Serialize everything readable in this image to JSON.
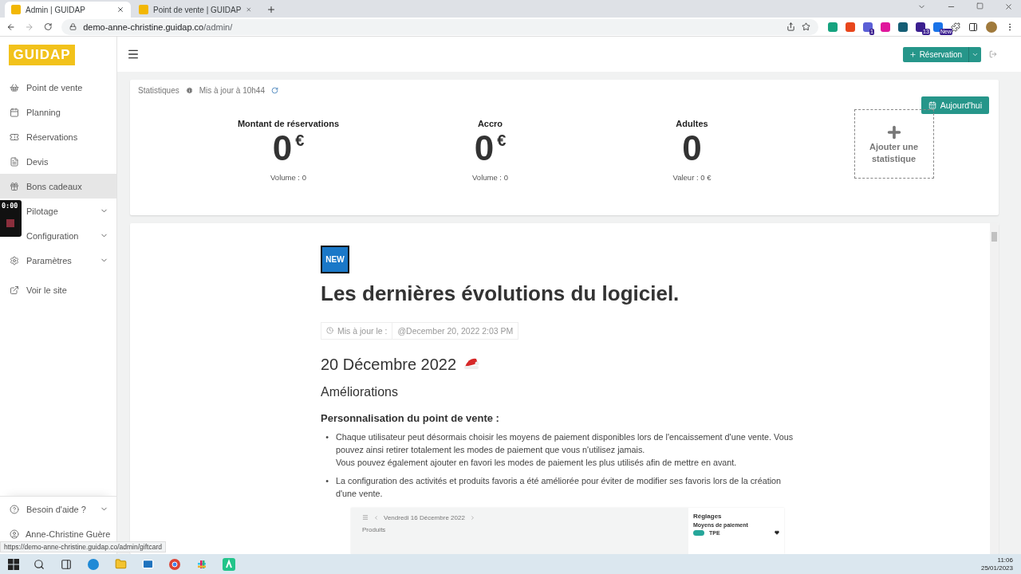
{
  "browser": {
    "tabs": [
      {
        "title": "Admin | GUIDAP",
        "selected": true
      },
      {
        "title": "Point de vente | GUIDAP",
        "selected": false
      }
    ],
    "url_host": "demo-anne-christine.guidap.co",
    "url_path": "/admin/",
    "extensions": [
      {
        "color": "#16a37f"
      },
      {
        "color": "#e8461c"
      },
      {
        "color": "#5b5fd6",
        "badge": "1"
      },
      {
        "color": "#e0179c"
      },
      {
        "color": "#155e75"
      },
      {
        "color": "#3b1f8f",
        "badge": "13"
      },
      {
        "color": "#1a73e8",
        "badge": "New"
      }
    ]
  },
  "sidebar": {
    "logo": "GUIDAP",
    "items": [
      {
        "label": "Point de vente",
        "hovered": false,
        "expandable": false
      },
      {
        "label": "Planning",
        "hovered": false,
        "expandable": false
      },
      {
        "label": "Réservations",
        "hovered": false,
        "expandable": false
      },
      {
        "label": "Devis",
        "hovered": false,
        "expandable": false
      },
      {
        "label": "Bons cadeaux",
        "hovered": true,
        "expandable": false
      },
      {
        "label": "Pilotage",
        "hovered": false,
        "expandable": true
      },
      {
        "label": "Configuration",
        "hovered": false,
        "expandable": true
      },
      {
        "label": "Paramètres",
        "hovered": false,
        "expandable": true
      },
      {
        "label": "Voir le site",
        "hovered": false,
        "expandable": false
      }
    ],
    "help": {
      "label": "Besoin d'aide ?",
      "expandable": true
    },
    "user": "Anne-Christine Guère"
  },
  "recorder": {
    "timer": "0:00"
  },
  "topbar": {
    "reservation_button": "Réservation"
  },
  "stats": {
    "label": "Statistiques",
    "updated": "Mis à jour à 10h44",
    "today_button": "Aujourd'hui",
    "cards": [
      {
        "title": "Montant de réservations",
        "value": "0",
        "unit": "€",
        "sub": "Volume : 0"
      },
      {
        "title": "Accro",
        "value": "0",
        "unit": "€",
        "sub": "Volume : 0"
      },
      {
        "title": "Adultes",
        "value": "0",
        "sub": "Valeur : 0 €"
      }
    ],
    "add": "Ajouter une statistique"
  },
  "article": {
    "badge": "NEW",
    "title": "Les dernières évolutions du logiciel.",
    "meta_label": "Mis à jour le :",
    "meta_value": "@December 20, 2022 2:03 PM",
    "date_heading": "20 Décembre 2022",
    "section": "Améliorations",
    "subsection": "Personnalisation du point de vente :",
    "bullet_marker": "•",
    "bullets": [
      [
        "Chaque utilisateur peut désormais choisir les moyens de paiement disponibles lors de l'encaissement d'une vente. Vous pouvez ainsi retirer totalement les modes de paiement que vous n'utilisez jamais.",
        "Vous pouvez également ajouter en favori les modes de paiement les plus utilisés afin de mettre en avant."
      ],
      [
        "La configuration des activités et produits favoris a été améliorée pour éviter de modifier ses favoris lors de la création d'une vente."
      ]
    ],
    "screenshot": {
      "date": "Vendredi 16 Décembre 2022",
      "tab": "Produits",
      "panel_title": "Réglages",
      "panel_label": "Moyens de paiement",
      "option": "TPE",
      "option_on": true
    }
  },
  "status_url": "https://demo-anne-christine.guidap.co/admin/giftcard",
  "taskbar": {
    "time": "11:06",
    "date": "25/01/2023"
  }
}
